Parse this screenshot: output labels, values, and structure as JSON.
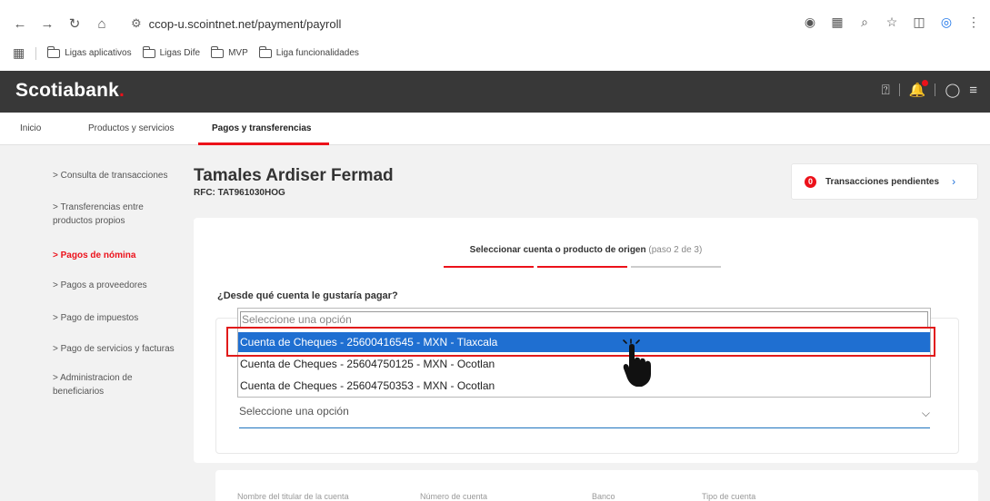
{
  "browser": {
    "url": "ccop-u.scointnet.net/payment/payroll",
    "bookmarks": [
      "Ligas aplicativos",
      "Ligas Dife",
      "MVP",
      "Liga funcionalidades"
    ]
  },
  "header": {
    "logo_text": "Scotiabank",
    "logo_dot": "."
  },
  "topnav": {
    "items": [
      "Inicio",
      "Productos y servicios",
      "Pagos y transferencias"
    ]
  },
  "sidebar": {
    "items": [
      "> Consulta de transacciones",
      "> Transferencias entre productos propios",
      "> Pagos de nómina",
      "> Pagos a proveedores",
      "> Pago de impuestos",
      "> Pago de servicios y facturas",
      "> Administracion de beneficiarios"
    ]
  },
  "main": {
    "client_name": "Tamales Ardiser Fermad",
    "rfc": "RFC: TAT961030HOG",
    "pending_count": "0",
    "pending_label": "Transacciones pendientes",
    "step_title": "Seleccionar cuenta o producto de origen",
    "step_sub": "(paso 2 de 3)",
    "question": "¿Desde qué cuenta le gustaría pagar?",
    "select_placeholder": "Seleccione una opción",
    "list_columns": [
      "Nombre del titular de la cuenta",
      "Número de cuenta",
      "Banco",
      "Tipo de cuenta"
    ]
  },
  "dropdown": {
    "placeholder": "Seleccione una opción",
    "options": [
      "Cuenta de Cheques - 25600416545 - MXN - Tlaxcala",
      "Cuenta de Cheques - 25604750125 - MXN - Ocotlan",
      "Cuenta de Cheques - 25604750353 - MXN - Ocotlan"
    ],
    "selected_index": 0
  },
  "colors": {
    "brand_red": "#ec111a",
    "header_bg": "#383838",
    "select_blue": "#1f6fd1"
  }
}
